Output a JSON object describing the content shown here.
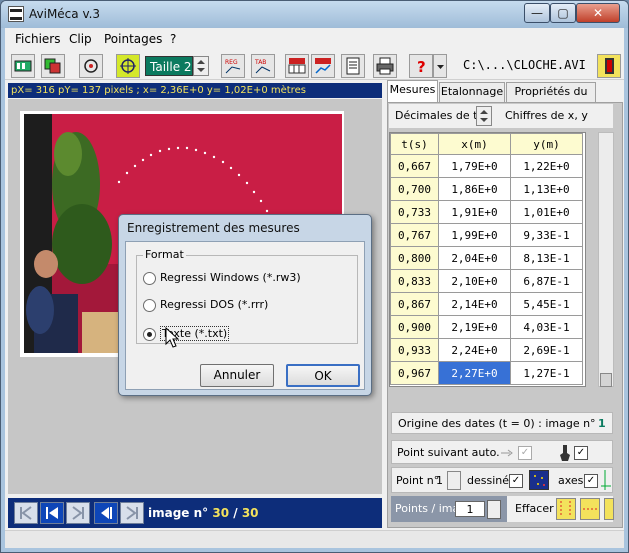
{
  "window": {
    "title": "AviMéca v.3",
    "minimize": "—",
    "maximize": "▢",
    "close": "✕"
  },
  "menu": [
    "Fichiers",
    "Clip",
    "Pointages",
    "?"
  ],
  "toolbar": {
    "taille_label": "Taille 2",
    "file_path": "C:\\...\\CLOCHE.AVI"
  },
  "status_text": "pX= 316  pY= 137 pixels  ;  x= 2,36E+0  y= 1,02E+0 mètres",
  "dialog": {
    "title": "Enregistrement des mesures",
    "group_label": "Format",
    "options": [
      {
        "label": "Regressi Windows (*.rw3)",
        "selected": false
      },
      {
        "label": "Regressi DOS (*.rrr)",
        "selected": false
      },
      {
        "label": "Texte (*.txt)",
        "selected": true
      }
    ],
    "cancel": "Annuler",
    "ok": "OK"
  },
  "nav": {
    "prefix": "image n°",
    "current": "30",
    "sep": "/",
    "total": "30"
  },
  "tabs": [
    "Mesures",
    "Etalonnage",
    "Propriétés du clip"
  ],
  "mesures": {
    "decimals_label": "Décimales de t",
    "digits_label": "Chiffres de x, y",
    "columns": [
      "t(s)",
      "x(m)",
      "y(m)"
    ],
    "rows": [
      [
        "0,667",
        "1,79E+0",
        "1,22E+0"
      ],
      [
        "0,700",
        "1,86E+0",
        "1,13E+0"
      ],
      [
        "0,733",
        "1,91E+0",
        "1,01E+0"
      ],
      [
        "0,767",
        "1,99E+0",
        "9,33E-1"
      ],
      [
        "0,800",
        "2,04E+0",
        "8,13E-1"
      ],
      [
        "0,833",
        "2,10E+0",
        "6,87E-1"
      ],
      [
        "0,867",
        "2,14E+0",
        "5,45E-1"
      ],
      [
        "0,900",
        "2,19E+0",
        "4,03E-1"
      ],
      [
        "0,933",
        "2,24E+0",
        "2,69E-1"
      ],
      [
        "0,967",
        "2,27E+0",
        "1,27E-1"
      ]
    ],
    "selected_row": 9,
    "selected_col": 1,
    "origin_label": "Origine des dates (t = 0) : image n°",
    "origin_value": "1",
    "point_suivant_label": "Point suivant auto.",
    "point_no_label": "Point n°",
    "point_no_value": "1",
    "dessine_label": "dessiné",
    "axes_label": "axes",
    "points_per_image_label": "Points / image",
    "points_per_image_value": "1",
    "effacer_label": "Effacer"
  }
}
